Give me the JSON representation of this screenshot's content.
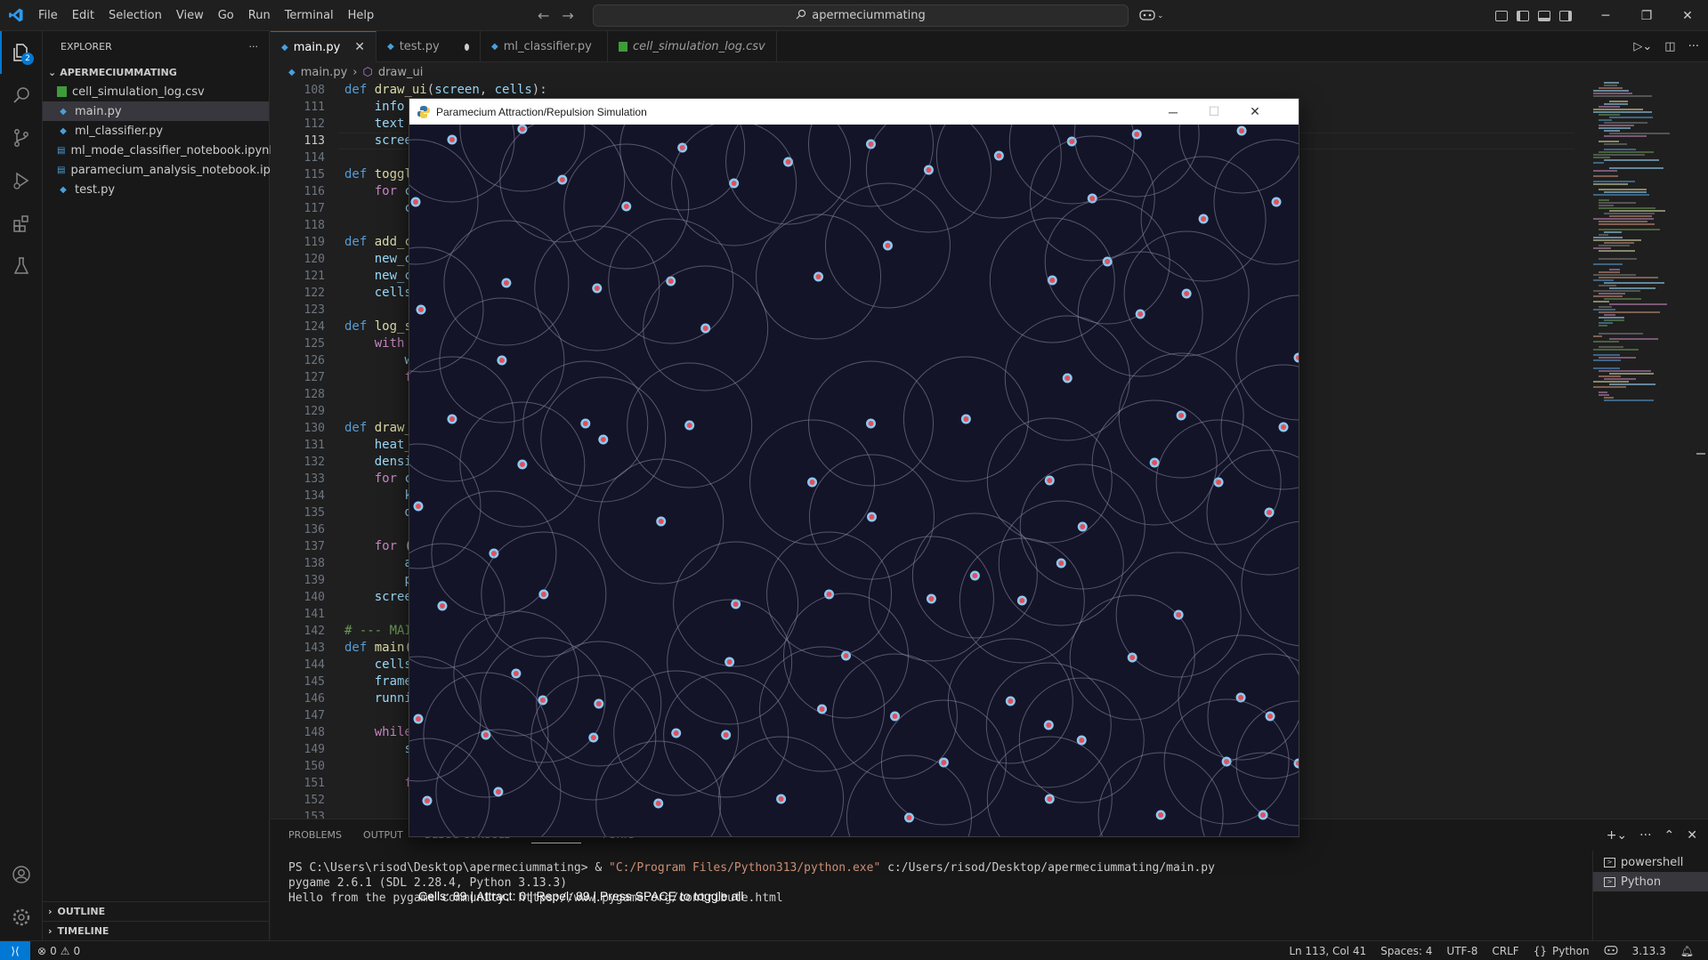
{
  "titlebar": {
    "menus": [
      "File",
      "Edit",
      "Selection",
      "View",
      "Go",
      "Run",
      "Terminal",
      "Help"
    ],
    "search_text": "apermeciummating"
  },
  "activity": {
    "explorer_badge": "2"
  },
  "sidebar": {
    "header": "EXPLORER",
    "more": "···",
    "folder": "APERMECIUMMATING",
    "files": [
      {
        "name": "cell_simulation_log.csv",
        "type": "csv"
      },
      {
        "name": "main.py",
        "type": "py",
        "selected": true
      },
      {
        "name": "ml_classifier.py",
        "type": "py"
      },
      {
        "name": "ml_mode_classifier_notebook.ipynb",
        "type": "ipynb"
      },
      {
        "name": "paramecium_analysis_notebook.ipynb",
        "type": "ipynb"
      },
      {
        "name": "test.py",
        "type": "py"
      }
    ],
    "outline": "OUTLINE",
    "timeline": "TIMELINE"
  },
  "tabs": [
    {
      "label": "main.py",
      "active": true
    },
    {
      "label": "test.py",
      "dirty": true
    },
    {
      "label": "ml_classifier.py",
      "dirty": true
    },
    {
      "label": "cell_simulation_log.csv",
      "italic": true
    }
  ],
  "breadcrumb": {
    "file": "main.py",
    "symbol": "draw_ui"
  },
  "editor": {
    "current_line": 113,
    "lines": [
      {
        "n": 108,
        "html": "<span class='kw'>def</span> <span class='fn'>draw_ui</span>(<span class='var'>screen</span>, <span class='var'>cells</span>):"
      },
      {
        "n": 111,
        "html": "    <span class='var'>info</span> = "
      },
      {
        "n": 112,
        "html": "    <span class='var'>text</span> = "
      },
      {
        "n": 113,
        "html": "    <span class='var'>screen</span>.b"
      },
      {
        "n": 114,
        "html": ""
      },
      {
        "n": 115,
        "html": "<span class='kw'>def</span> <span class='fn'>toggle_a</span>"
      },
      {
        "n": 116,
        "html": "    <span class='kw2'>for</span> <span class='var'>c</span> <span class='kw2'>in</span>"
      },
      {
        "n": 117,
        "html": "        <span class='var'>c</span>.a"
      },
      {
        "n": 118,
        "html": ""
      },
      {
        "n": 119,
        "html": "<span class='kw'>def</span> <span class='fn'>add_cell</span>"
      },
      {
        "n": 120,
        "html": "    <span class='var'>new_cell</span>"
      },
      {
        "n": 121,
        "html": "    <span class='var'>new_cell</span>"
      },
      {
        "n": 122,
        "html": "    <span class='var'>cells</span>.ap"
      },
      {
        "n": 123,
        "html": ""
      },
      {
        "n": 124,
        "html": "<span class='kw'>def</span> <span class='fn'>log_stat</span>"
      },
      {
        "n": 125,
        "html": "    <span class='kw2'>with</span> <span class='fn'>ope</span>"
      },
      {
        "n": 126,
        "html": "        <span class='var'>writ</span>"
      },
      {
        "n": 127,
        "html": "        <span class='kw2'>for</span>"
      },
      {
        "n": 128,
        "html": ""
      },
      {
        "n": 129,
        "html": ""
      },
      {
        "n": 130,
        "html": "<span class='kw'>def</span> <span class='fn'>draw_hea</span>"
      },
      {
        "n": 131,
        "html": "    <span class='var'>heat_sur</span>"
      },
      {
        "n": 132,
        "html": "    <span class='var'>density</span>"
      },
      {
        "n": 133,
        "html": "    <span class='kw2'>for</span> <span class='var'>c</span> <span class='kw2'>in</span>"
      },
      {
        "n": 134,
        "html": "        <span class='var'>key</span>"
      },
      {
        "n": 135,
        "html": "        <span class='var'>dens</span>"
      },
      {
        "n": 136,
        "html": ""
      },
      {
        "n": 137,
        "html": "    <span class='kw2'>for</span> (<span class='var'>gx</span>,"
      },
      {
        "n": 138,
        "html": "        <span class='var'>alph</span>"
      },
      {
        "n": 139,
        "html": "        <span class='var'>pyga</span>"
      },
      {
        "n": 140,
        "html": "    <span class='var'>screen</span>.b"
      },
      {
        "n": 141,
        "html": ""
      },
      {
        "n": 142,
        "html": "<span class='cm'># --- MAIN</span>"
      },
      {
        "n": 143,
        "html": "<span class='kw'>def</span> <span class='fn'>main</span>():"
      },
      {
        "n": 144,
        "html": "    <span class='var'>cells</span> ="
      },
      {
        "n": 145,
        "html": "    <span class='var'>frame</span> ="
      },
      {
        "n": 146,
        "html": "    <span class='var'>running</span>"
      },
      {
        "n": 147,
        "html": ""
      },
      {
        "n": 148,
        "html": "    <span class='kw2'>while</span> <span class='var'>ru</span>"
      },
      {
        "n": 149,
        "html": "        <span class='var'>scre</span>"
      },
      {
        "n": 150,
        "html": ""
      },
      {
        "n": 151,
        "html": "        <span class='kw2'>for</span>"
      },
      {
        "n": 152,
        "html": ""
      },
      {
        "n": 153,
        "html": ""
      }
    ]
  },
  "panel": {
    "tabs": [
      "PROBLEMS",
      "OUTPUT",
      "DEBUG CONSOLE",
      "TERMINAL",
      "PORTS"
    ],
    "active_tab": "TERMINAL",
    "terminal_prompt": "PS C:\\Users\\risod\\Desktop\\apermeciummating> & ",
    "terminal_exe": "\"C:/Program Files/Python313/python.exe\"",
    "terminal_arg": " c:/Users/risod/Desktop/apermeciummating/main.py",
    "terminal_line2": "pygame 2.6.1 (SDL 2.28.4, Python 3.13.3)",
    "terminal_line3": "Hello from the pygame community. https://www.pygame.org/contribute.html",
    "terminals": [
      "powershell",
      "Python"
    ]
  },
  "statusbar": {
    "errors": "0",
    "warnings": "0",
    "position": "Ln 113, Col 41",
    "spaces": "Spaces: 4",
    "encoding": "UTF-8",
    "eol": "CRLF",
    "language": "Python",
    "python_version": "3.13.3"
  },
  "pygame": {
    "title": "Paramecium Attraction/Repulsion Simulation",
    "status": "Cells: 89 | Attract: 0 | Repel: 89 | Press SPACE to toggle all",
    "colors": {
      "background": "#141428",
      "cell_fill": "#e0505a",
      "cell_ring": "#8ec8f0",
      "radius_line": "#8a8ca8"
    }
  }
}
